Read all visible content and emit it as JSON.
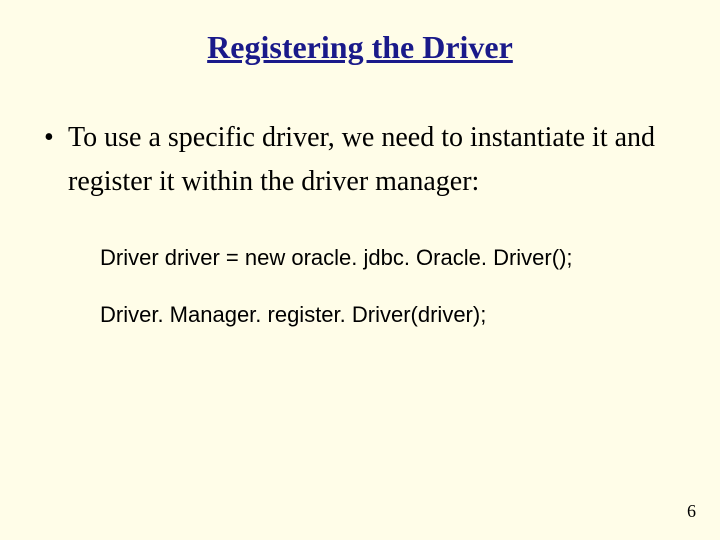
{
  "slide": {
    "title": "Registering the Driver",
    "bullet": "To use a specific driver, we need to instantiate it and register it within the driver manager:",
    "code": {
      "line1": "Driver driver = new oracle. jdbc. Oracle. Driver();",
      "line2": "Driver. Manager. register. Driver(driver);"
    },
    "page_number": "6"
  }
}
